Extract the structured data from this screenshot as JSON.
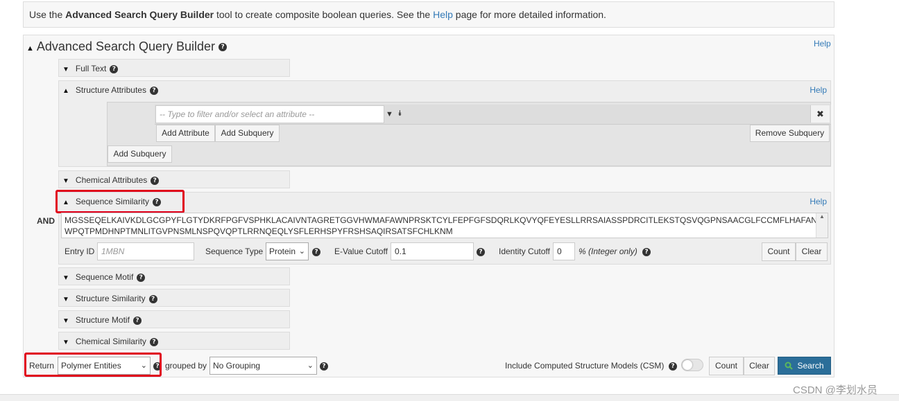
{
  "banner": {
    "prefix": "Use the ",
    "bold": "Advanced Search Query Builder",
    "mid": " tool to create composite boolean queries. See the ",
    "link": "Help",
    "suffix": " page for more detailed information."
  },
  "builder": {
    "title": "Advanced Search Query Builder",
    "help": "Help"
  },
  "panels": {
    "full_text": "Full Text",
    "structure_attributes": "Structure Attributes",
    "chemical_attributes": "Chemical Attributes",
    "sequence_similarity": "Sequence Similarity",
    "sequence_motif": "Sequence Motif",
    "structure_similarity": "Structure Similarity",
    "structure_motif": "Structure Motif",
    "chemical_similarity": "Chemical Similarity"
  },
  "structure_attr": {
    "help": "Help",
    "attribute_placeholder": "-- Type to filter and/or select an attribute --",
    "add_attribute": "Add Attribute",
    "add_subquery_inner": "Add Subquery",
    "remove_subquery": "Remove Subquery",
    "add_subquery_outer": "Add Subquery",
    "close_icon": "✖"
  },
  "sequence": {
    "help": "Help",
    "operator": "AND",
    "sequence_text": "MGSSEQELKAIVKDLGCGPYFLGTYDKRFPGFVSPHKLACAIVNTAGRETGGVHWMAFAWNPRSKTCYLFEPFGFSDQRLKQVYQFEYESLLRRSAIASSPDRCITLEKSTQSVQGPNSAACGLFCCMFLHAFANWPQTPMDHNPTMNLITGVPNSMLNSPQVQPTLRRNQEQLYSFLERHSPYFRSHSAQIRSATSFCHLKNM",
    "entry_id_label": "Entry ID",
    "entry_id_placeholder": "1MBN",
    "sequence_type_label": "Sequence Type",
    "sequence_type_value": "Protein",
    "evalue_label": "E-Value Cutoff",
    "evalue_value": "0.1",
    "identity_label": "Identity Cutoff",
    "identity_value": "0",
    "identity_unit": "% (Integer only)",
    "count": "Count",
    "clear": "Clear"
  },
  "bottom": {
    "return_label": "Return",
    "return_value": "Polymer Entities",
    "grouped_by_label": "grouped by",
    "grouping_value": "No Grouping",
    "csm_label": "Include Computed Structure Models (CSM)",
    "csm_enabled": false,
    "count": "Count",
    "clear": "Clear",
    "search": "Search"
  },
  "watermark": "CSDN @李划水员",
  "colors": {
    "link": "#337ab7",
    "highlight_box": "#e0001b",
    "search_button": "#2b6e99",
    "search_icon": "#5cb85c"
  }
}
